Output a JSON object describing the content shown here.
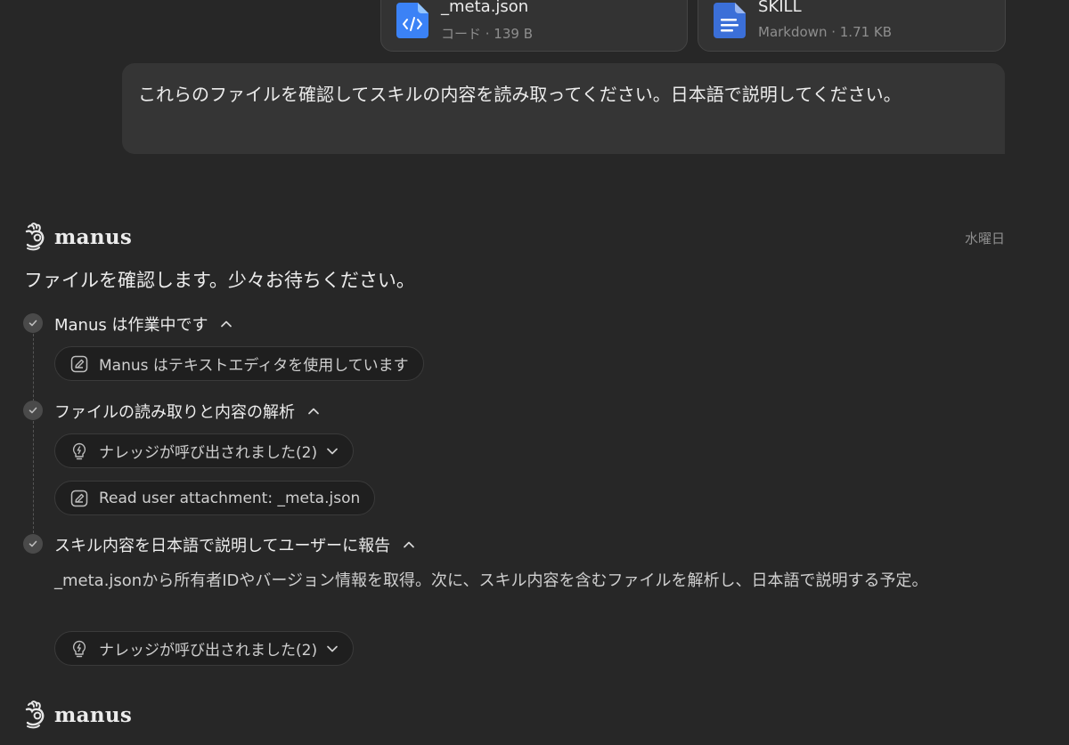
{
  "attachments": [
    {
      "name": "_meta.json",
      "meta": "コード · 139 B",
      "icon": "code-file-icon",
      "color": "#3b82f6"
    },
    {
      "name": "SKILL",
      "meta": "Markdown · 1.71 KB",
      "icon": "document-file-icon",
      "color": "#3b6fd8"
    }
  ],
  "user_message": "これらのファイルを確認してスキルの内容を読み取ってください。日本語で説明してください。",
  "assistant": {
    "name": "manus",
    "day": "水曜日",
    "intro": "ファイルを確認します。少々お待ちください。",
    "steps": [
      {
        "title": "Manus は作業中です",
        "items": [
          {
            "label": "Manus はテキストエディタを使用しています",
            "icon": "edit-icon"
          }
        ]
      },
      {
        "title": "ファイルの読み取りと内容の解析",
        "items": [
          {
            "label": "ナレッジが呼び出されました(2)",
            "icon": "lightbulb-icon"
          },
          {
            "label": "Read user attachment: _meta.json",
            "icon": "edit-icon"
          }
        ]
      },
      {
        "title": "スキル内容を日本語で説明してユーザーに報告",
        "description": "_meta.jsonから所有者IDやバージョン情報を取得。次に、スキル内容を含むファイルを解析し、日本語で説明する予定。",
        "items": [
          {
            "label": "ナレッジが呼び出されました(2)",
            "icon": "lightbulb-icon"
          }
        ]
      }
    ]
  },
  "assistant2": {
    "name": "manus"
  }
}
